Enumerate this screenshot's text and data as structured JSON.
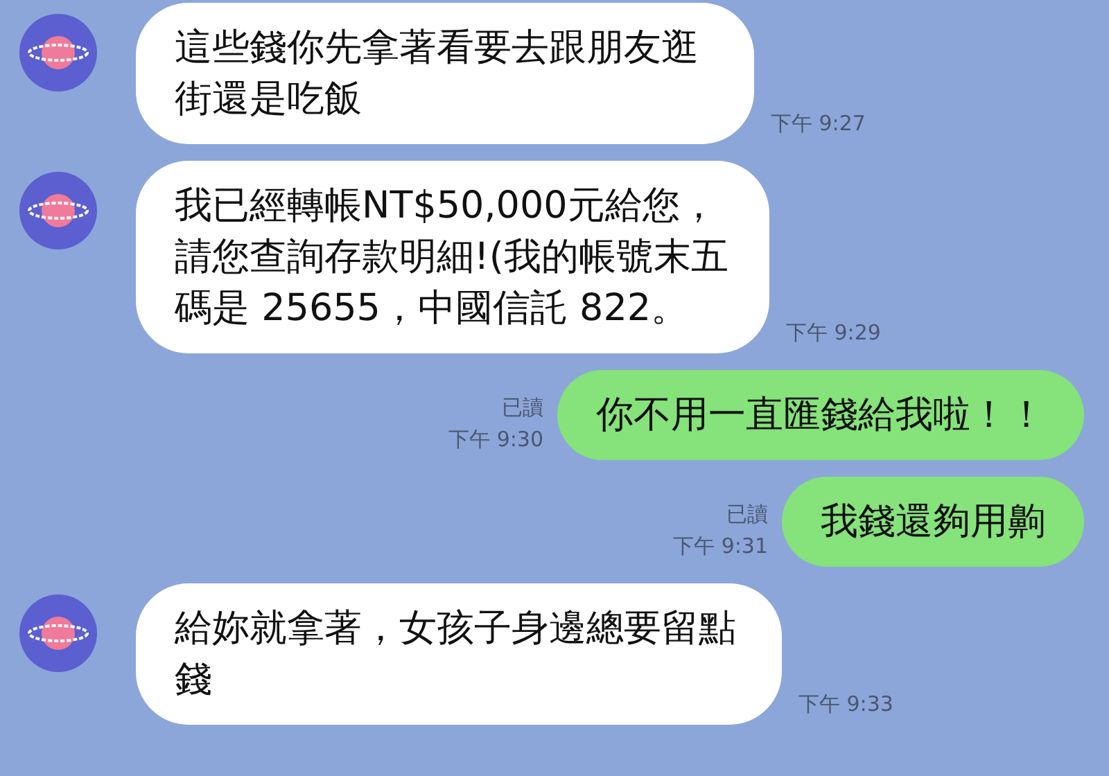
{
  "messages": [
    {
      "kind": "incoming",
      "text": "這些錢你先拿著看要去跟朋友逛街還是吃飯",
      "time": "下午 9:27"
    },
    {
      "kind": "incoming",
      "text": "我已經轉帳NT$50,000元給您，請您查詢存款明細!(我的帳號末五碼是 25655，中國信託 822。",
      "time": "下午 9:29"
    },
    {
      "kind": "outgoing",
      "text": "你不用一直匯錢給我啦！！",
      "read": "已讀",
      "time": "下午 9:30"
    },
    {
      "kind": "outgoing",
      "text": "我錢還夠用齁",
      "read": "已讀",
      "time": "下午 9:31"
    },
    {
      "kind": "incoming",
      "text": "給妳就拿著，女孩子身邊總要留點錢",
      "time": "下午 9:33"
    }
  ]
}
